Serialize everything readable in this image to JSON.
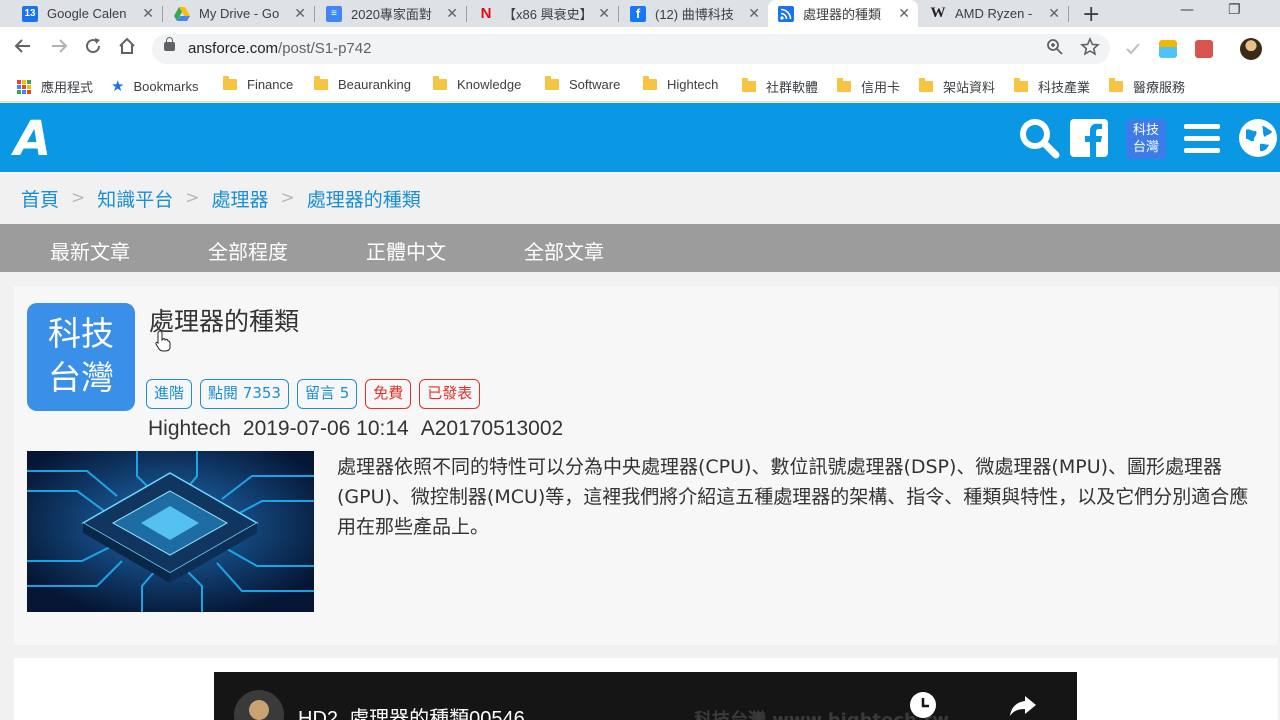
{
  "browser": {
    "tabs": [
      {
        "title": "Google Calen",
        "favicon": "google-calendar-icon",
        "favicon_text": "13",
        "color": "#1a73e8"
      },
      {
        "title": "My Drive - Go",
        "favicon": "google-drive-icon",
        "favicon_text": "",
        "color": "#34a853"
      },
      {
        "title": "2020專家面對",
        "favicon": "google-docs-icon",
        "favicon_text": "≡",
        "color": "#4285f4"
      },
      {
        "title": "【x86 興衰史】",
        "favicon": "netflix-n-icon",
        "favicon_text": "N",
        "color": "#e50914"
      },
      {
        "title": "(12) 曲博科技",
        "favicon": "facebook-icon",
        "favicon_text": "f",
        "color": "#1877f2"
      },
      {
        "title": "處理器的種類",
        "favicon": "rss-feed-icon",
        "favicon_text": "",
        "color": "#1a73e8",
        "active": true
      },
      {
        "title": "AMD Ryzen -",
        "favicon": "wikipedia-icon",
        "favicon_text": "W",
        "color": "#ffffff"
      }
    ],
    "close_glyph": "✕",
    "new_tab_glyph": "+",
    "window_controls": {
      "minimize": "—",
      "restore": "❐"
    },
    "url_host": "ansforce.com",
    "url_path": "/post/S1-p742",
    "bookmarks": [
      {
        "label": "應用程式",
        "icon": "apps-grid-icon"
      },
      {
        "label": "Bookmarks",
        "icon": "star-icon"
      },
      {
        "label": "Finance",
        "icon": "folder-icon"
      },
      {
        "label": "Beauranking",
        "icon": "folder-icon"
      },
      {
        "label": "Knowledge",
        "icon": "folder-icon"
      },
      {
        "label": "Software",
        "icon": "folder-icon"
      },
      {
        "label": "Hightech",
        "icon": "folder-icon"
      },
      {
        "label": "社群軟體",
        "icon": "folder-icon"
      },
      {
        "label": "信用卡",
        "icon": "folder-icon"
      },
      {
        "label": "架站資料",
        "icon": "folder-icon"
      },
      {
        "label": "科技產業",
        "icon": "folder-icon"
      },
      {
        "label": "醫療服務",
        "icon": "folder-icon"
      }
    ]
  },
  "site": {
    "logo_text": "A",
    "header_badge": [
      "科技",
      "台灣"
    ],
    "brand_color": "#0a97e3",
    "breadcrumb": [
      "首頁",
      "知識平台",
      "處理器",
      "處理器的種類"
    ],
    "breadcrumb_separator": ">",
    "menu": [
      "最新文章",
      "全部程度",
      "正體中文",
      "全部文章"
    ]
  },
  "post": {
    "badge": [
      "科技",
      "台灣"
    ],
    "title": "處理器的種類",
    "tags": [
      {
        "label": "進階",
        "style": "blue"
      },
      {
        "label": "點閱 7353",
        "style": "blue"
      },
      {
        "label": "留言 5",
        "style": "blue"
      },
      {
        "label": "免費",
        "style": "red"
      },
      {
        "label": "已發表",
        "style": "red"
      }
    ],
    "category": "Hightech",
    "date": "2019-07-06 10:14",
    "article_id": "A20170513002",
    "excerpt": "處理器依照不同的特性可以分為中央處理器(CPU)、數位訊號處理器(DSP)、微處理器(MPU)、圖形處理器(GPU)、微控制器(MCU)等，這裡我們將介紹這五種處理器的架構、指令、種類與特性，以及它們分別適合應用在那些產品上。"
  },
  "video": {
    "title": "HD2_處理器的種類00546",
    "watermark": "科技台灣 www.hightech.tw"
  }
}
